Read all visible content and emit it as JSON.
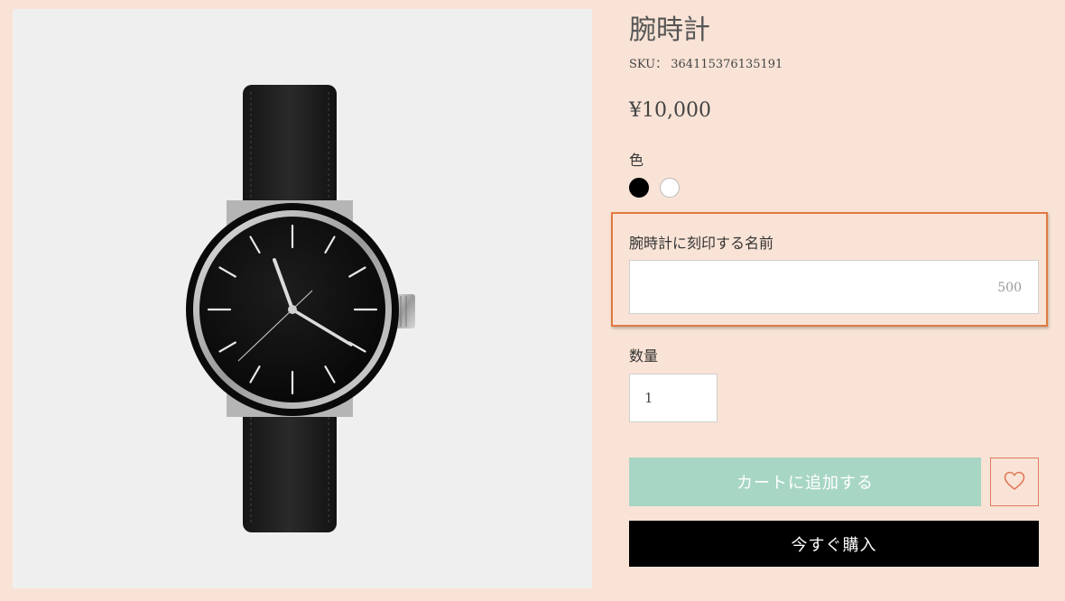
{
  "product": {
    "title": "腕時計",
    "sku_label": "SKU：",
    "sku_value": "364115376135191",
    "price": "¥10,000"
  },
  "color": {
    "label": "色",
    "options": [
      {
        "name": "black",
        "hex": "#000000"
      },
      {
        "name": "white",
        "hex": "#ffffff"
      }
    ]
  },
  "engraving": {
    "label": "腕時計に刻印する名前",
    "value": "",
    "char_limit": "500"
  },
  "quantity": {
    "label": "数量",
    "value": "1"
  },
  "actions": {
    "add_to_cart": "カートに追加する",
    "buy_now": "今すぐ購入"
  },
  "colors": {
    "page_background": "#f9e3d6",
    "add_to_cart_bg": "#a8d6c5",
    "buy_now_bg": "#000000",
    "highlight_border": "#e07a3f",
    "wishlist_accent": "#e07a5a"
  },
  "icons": [
    "heart-icon"
  ]
}
